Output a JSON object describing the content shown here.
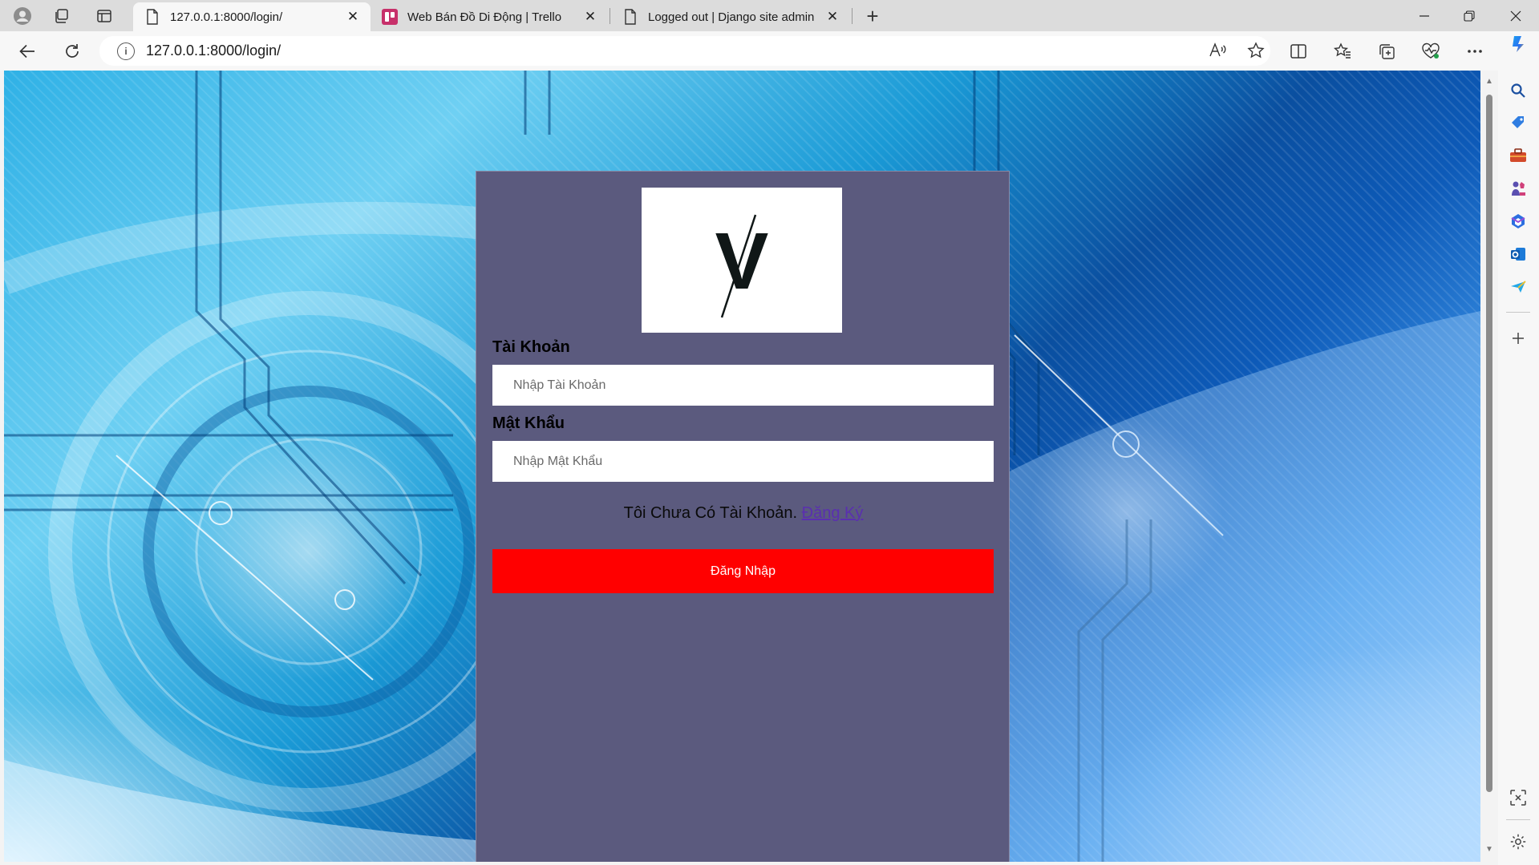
{
  "browser": {
    "tabs": [
      {
        "title": "127.0.0.1:8000/login/",
        "active": true,
        "favicon": "page-icon"
      },
      {
        "title": "Web Bán Đồ Di Động | Trello",
        "active": false,
        "favicon": "trello-icon"
      },
      {
        "title": "Logged out | Django site admin",
        "active": false,
        "favicon": "page-icon"
      }
    ],
    "url": "127.0.0.1:8000/login/"
  },
  "login": {
    "logo_letter": "V",
    "username_label": "Tài Khoản",
    "username_placeholder": "Nhập Tài Khoản",
    "password_label": "Mật Khẩu",
    "password_placeholder": "Nhập Mật Khẩu",
    "no_account_text": "Tôi Chưa Có Tài Khoản. ",
    "register_link": "Đăng Ký",
    "submit_label": "Đăng Nhập"
  },
  "colors": {
    "card_bg": "#5b5a7e",
    "submit_bg": "#ff0000",
    "link": "#5a2fb0"
  }
}
